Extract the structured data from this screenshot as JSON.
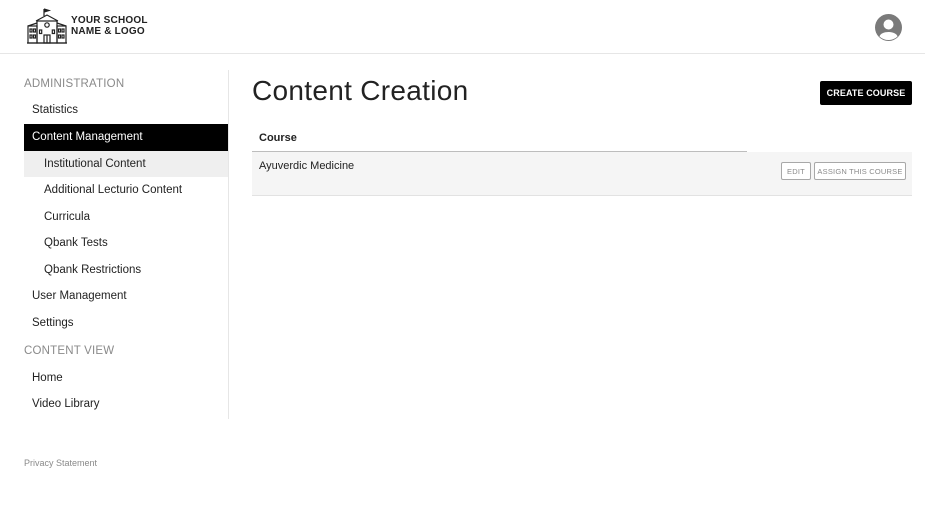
{
  "header": {
    "logo": {
      "line1": "YOUR SCHOOL",
      "line2": "NAME & LOGO",
      "icon": "school-building-icon"
    },
    "avatar_icon": "user-avatar-icon"
  },
  "sidebar": {
    "admin_heading": "ADMINISTRATION",
    "admin_items": [
      {
        "label": "Statistics"
      },
      {
        "label": "Content Management"
      },
      {
        "label": "Institutional Content"
      },
      {
        "label": "Additional Lecturio Content"
      },
      {
        "label": "Curricula"
      },
      {
        "label": "Qbank Tests"
      },
      {
        "label": "Qbank Restrictions"
      },
      {
        "label": "User Management"
      },
      {
        "label": "Settings"
      }
    ],
    "content_heading": "CONTENT VIEW",
    "content_items": [
      {
        "label": "Home"
      },
      {
        "label": "Video Library"
      }
    ],
    "privacy": "Privacy Statement"
  },
  "main": {
    "title": "Content Creation",
    "create_button": "CREATE COURSE",
    "table": {
      "header": "Course",
      "rows": [
        {
          "name": "Ayuverdic Medicine",
          "edit": "EDIT",
          "assign": "ASSIGN THIS COURSE"
        }
      ]
    }
  },
  "colors": {
    "active_bg": "#000000",
    "sub_active_bg": "#efefef",
    "muted_text": "#8a8a8a"
  }
}
